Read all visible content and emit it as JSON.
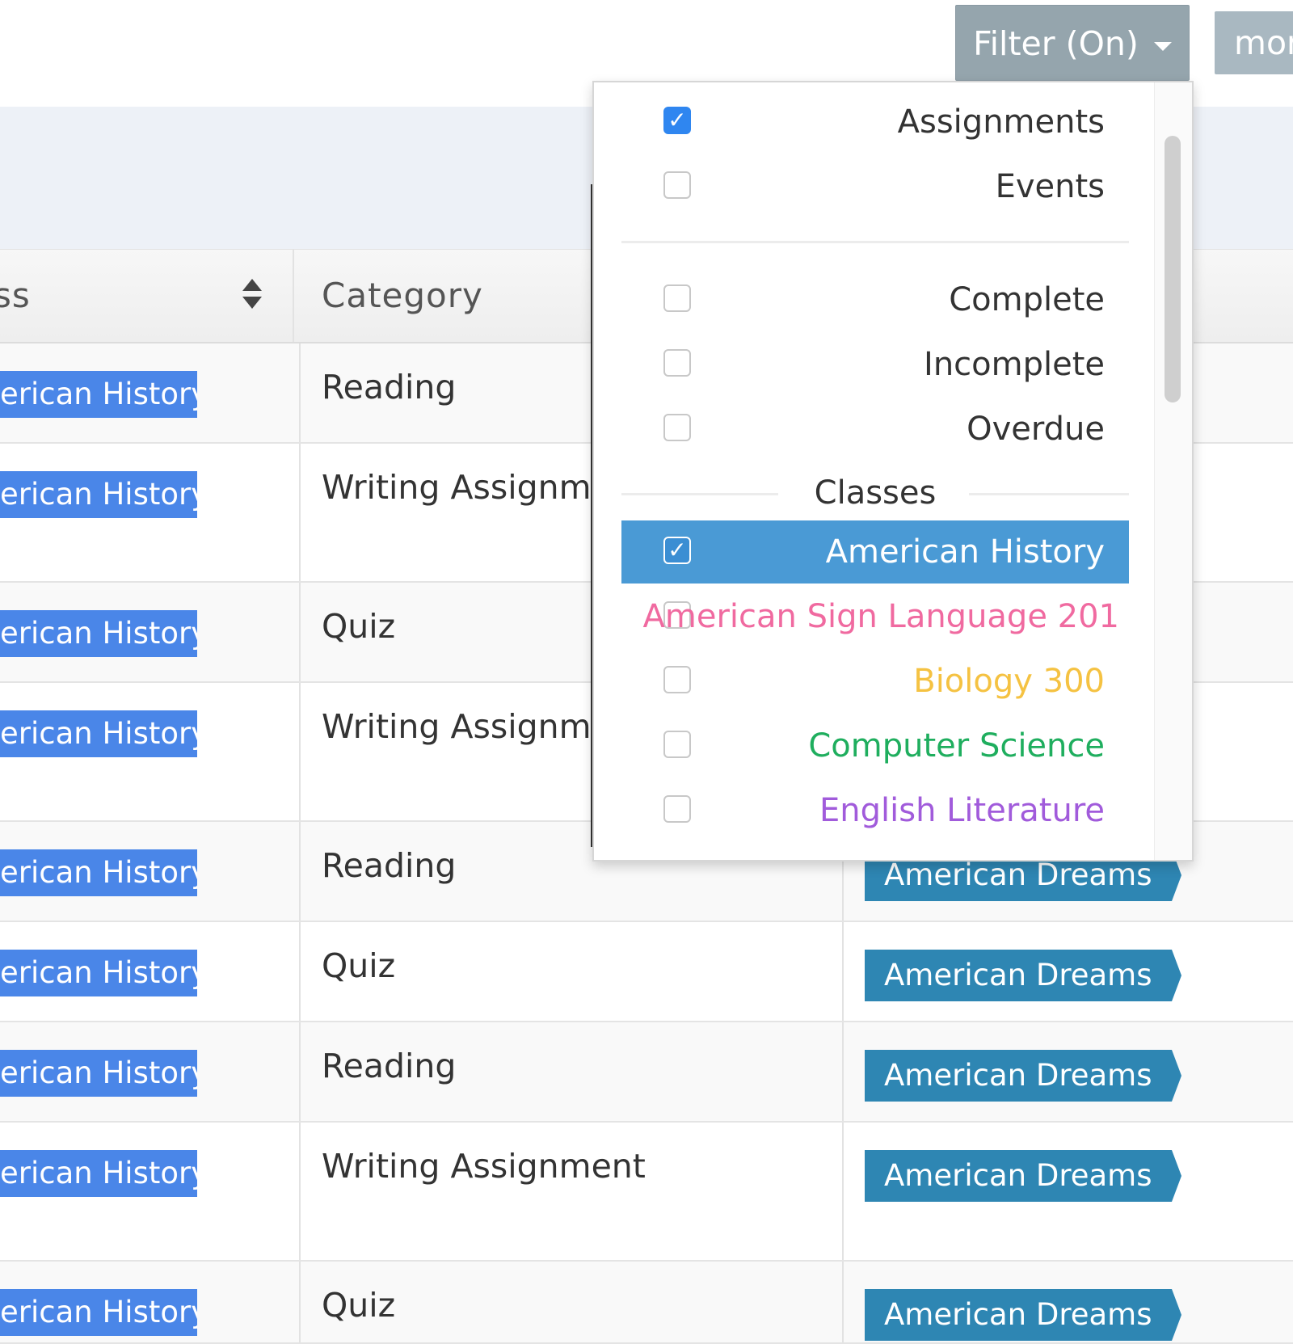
{
  "toolbar": {
    "filter_label": "Filter (On)",
    "more_label": "mor"
  },
  "table": {
    "headers": {
      "class": "ss",
      "category": "Category"
    },
    "rows": [
      {
        "class": "erican History",
        "category": "Reading",
        "unit": ""
      },
      {
        "class": "erican History",
        "category": "Writing Assignment",
        "unit": ""
      },
      {
        "class": "erican History",
        "category": "Quiz",
        "unit": ""
      },
      {
        "class": "erican History",
        "category": "Writing Assignment",
        "unit": ""
      },
      {
        "class": "erican History",
        "category": "Reading",
        "unit": "American Dreams"
      },
      {
        "class": "erican History",
        "category": "Quiz",
        "unit": "American Dreams"
      },
      {
        "class": "erican History",
        "category": "Reading",
        "unit": "American Dreams"
      },
      {
        "class": "erican History",
        "category": "Writing Assignment",
        "unit": "American Dreams"
      },
      {
        "class": "erican History",
        "category": "Quiz",
        "unit": "American Dreams"
      }
    ]
  },
  "filter_menu": {
    "types": [
      {
        "label": "Assignments",
        "checked": true
      },
      {
        "label": "Events",
        "checked": false
      }
    ],
    "statuses": [
      {
        "label": "Complete",
        "checked": false
      },
      {
        "label": "Incomplete",
        "checked": false
      },
      {
        "label": "Overdue",
        "checked": false
      }
    ],
    "classes_heading": "Classes",
    "classes": [
      {
        "label": "American History",
        "checked": true,
        "color": "#ffffff"
      },
      {
        "label": "American Sign Language 201",
        "checked": false,
        "color": "#f06aa0"
      },
      {
        "label": "Biology 300",
        "checked": false,
        "color": "#f5c242"
      },
      {
        "label": "Computer Science",
        "checked": false,
        "color": "#1fae5e"
      },
      {
        "label": "English Literature",
        "checked": false,
        "color": "#a15bdb"
      }
    ]
  },
  "colors": {
    "class_tag": "#4a86e8",
    "unit_tag": "#2e86b3",
    "selected_item": "#4a9ad5",
    "checkbox_checked": "#2f86f0",
    "filter_button": "#95a5ad"
  },
  "icons": {
    "sort": "sort-icon",
    "caret": "caret-down-icon",
    "check": "check-icon"
  }
}
